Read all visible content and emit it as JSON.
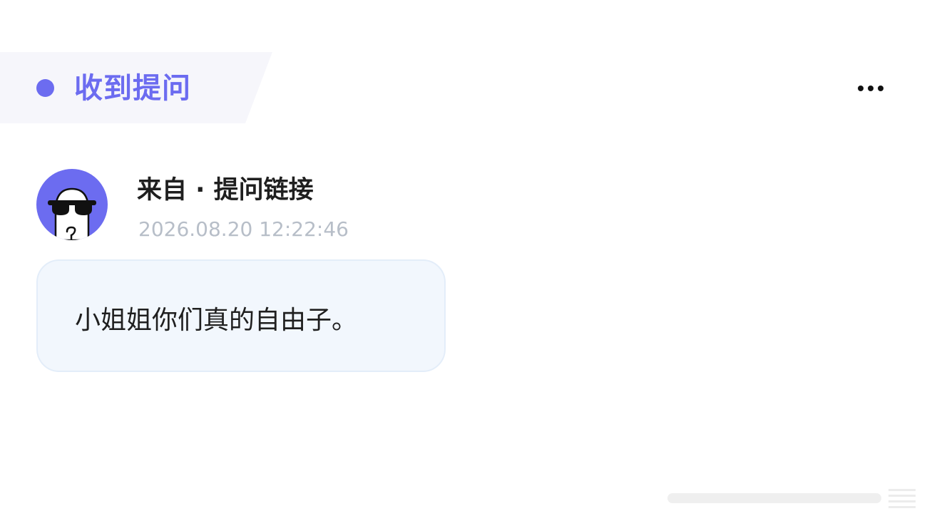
{
  "header": {
    "title": "收到提问",
    "accent_color": "#6c6cf0",
    "more_icon": "more-horizontal-icon"
  },
  "question": {
    "sender": "来自 · 提问链接",
    "timestamp": "2026.08.20 12:22:46",
    "text": "小姐姐你们真的自由子。"
  },
  "avatar": {
    "icon": "sunglasses-ghost-avatar"
  }
}
